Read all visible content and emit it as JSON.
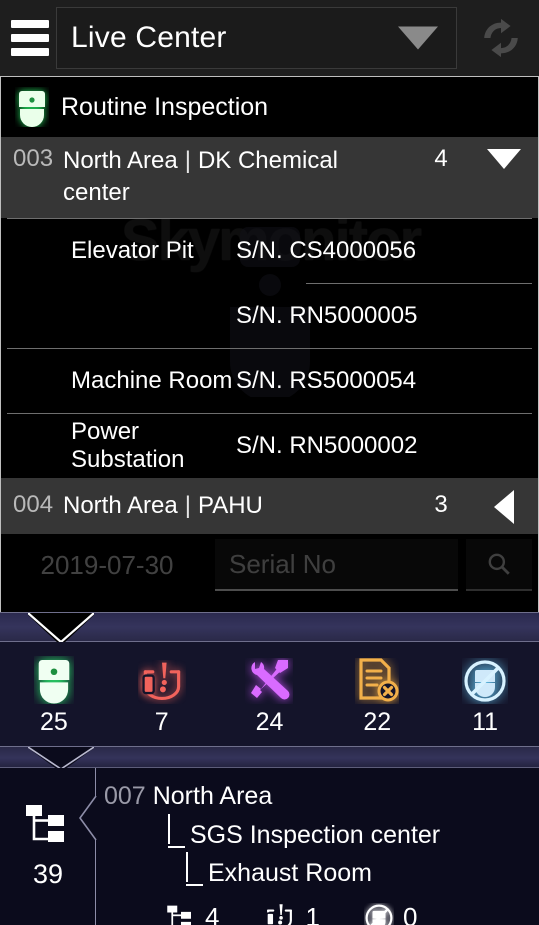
{
  "header": {
    "menu_icon": "hamburger-icon",
    "title": "Live Center",
    "dropdown_icon": "caret-down-icon",
    "refresh_icon": "refresh-icon"
  },
  "list": {
    "section": {
      "icon": "elevator-cab-icon",
      "label": "Routine Inspection"
    },
    "groups": [
      {
        "number": "003",
        "area": "North Area",
        "separator": "|",
        "site": "DK Chemical center",
        "count": "4",
        "arrow": "triangle-down-icon",
        "expanded": true,
        "items": [
          {
            "name": "Elevator Pit",
            "serial": "S/N. CS4000056"
          },
          {
            "name": "",
            "serial": "S/N. RN5000005"
          },
          {
            "name": "Machine Room",
            "serial": "S/N. RS5000054"
          },
          {
            "name": "Power Substation",
            "serial": "S/N. RN5000002"
          }
        ]
      },
      {
        "number": "004",
        "area": "North Area",
        "separator": "|",
        "site": "PAHU",
        "count": "3",
        "arrow": "triangle-left-icon",
        "expanded": false,
        "items": []
      }
    ],
    "search": {
      "date": "2019-07-30",
      "placeholder": "Serial No",
      "value": "",
      "button_icon": "search-icon"
    },
    "watermark": "Skymonitor"
  },
  "stats": {
    "items": [
      {
        "icon": "elevator-cab-icon",
        "value": "25",
        "color": "#3ef07a"
      },
      {
        "icon": "emergency-call-icon",
        "value": "7",
        "color": "#f0554f"
      },
      {
        "icon": "tools-icon",
        "value": "24",
        "color": "#c44ff0"
      },
      {
        "icon": "document-error-icon",
        "value": "22",
        "color": "#f0a93c"
      },
      {
        "icon": "no-elevator-icon",
        "value": "11",
        "color": "#5fc8f5"
      }
    ]
  },
  "tree": {
    "summary_icon": "sitemap-icon",
    "summary_count": "39",
    "chevron_icon": "chevron-left-icon",
    "node_number": "007",
    "level1": "North Area",
    "level2": "SGS Inspection center",
    "level3": "Exhaust Room",
    "stats": [
      {
        "icon": "sitemap-icon",
        "value": "4"
      },
      {
        "icon": "emergency-call-icon",
        "value": "1"
      },
      {
        "icon": "no-elevator-icon",
        "value": "0"
      }
    ]
  },
  "colors": {
    "background": "#000000",
    "header_bg": "#1e1e1e",
    "group_row_bg": "#363636",
    "band": "#34335a",
    "icons_panel_bg": "#14142a",
    "tree_panel_bg": "#0b0b1c"
  }
}
